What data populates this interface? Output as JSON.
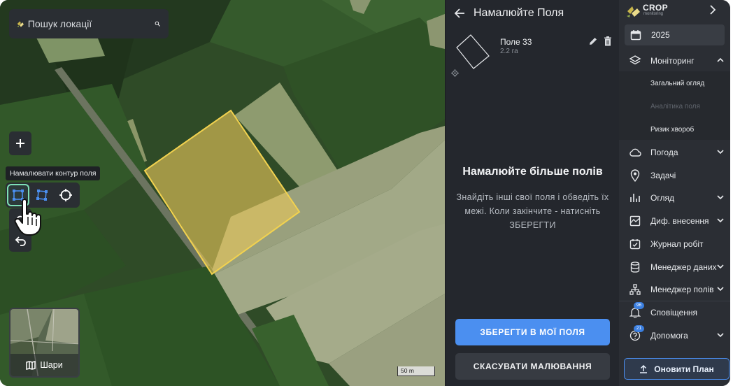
{
  "map": {
    "search_placeholder": "Пошук локації",
    "tooltip": "Намалювати контур поля",
    "layers_label": "Шари",
    "scale_label": "50 m",
    "drawn_field_color": "#e8c75a"
  },
  "panel": {
    "title": "Намалюйте Поля",
    "field": {
      "name": "Поле 33",
      "area": "2.2 га"
    },
    "empty_title": "Намалюйте більше полів",
    "empty_text": "Знайдіть інші свої поля і обведіть їх межі. Коли закінчите - натисніть ЗБЕРЕГТИ",
    "save_button": "ЗБЕРЕГТИ В МОЇ ПОЛЯ",
    "cancel_button": "СКАСУВАТИ МАЛЮВАННЯ"
  },
  "nav": {
    "brand": "CROP",
    "brand_sub": "monitoring",
    "year": "2025",
    "monitoring": "Моніторинг",
    "submenu": [
      "Загальний огляд",
      "Аналітика поля",
      "Ризик хвороб"
    ],
    "weather": "Погода",
    "tasks": "Задачі",
    "overview": "Огляд",
    "variable_rate": "Диф. внесення",
    "work_log": "Журнал робіт",
    "data_manager": "Менеджер даних",
    "field_manager": "Менеджер полів",
    "notifications": "Сповіщення",
    "notifications_count": "96",
    "help": "Допомога",
    "help_count": "21",
    "upgrade_button": "Оновити План"
  },
  "colors": {
    "accent": "#4b8ff0",
    "active_tool": "#7ee0b6"
  }
}
